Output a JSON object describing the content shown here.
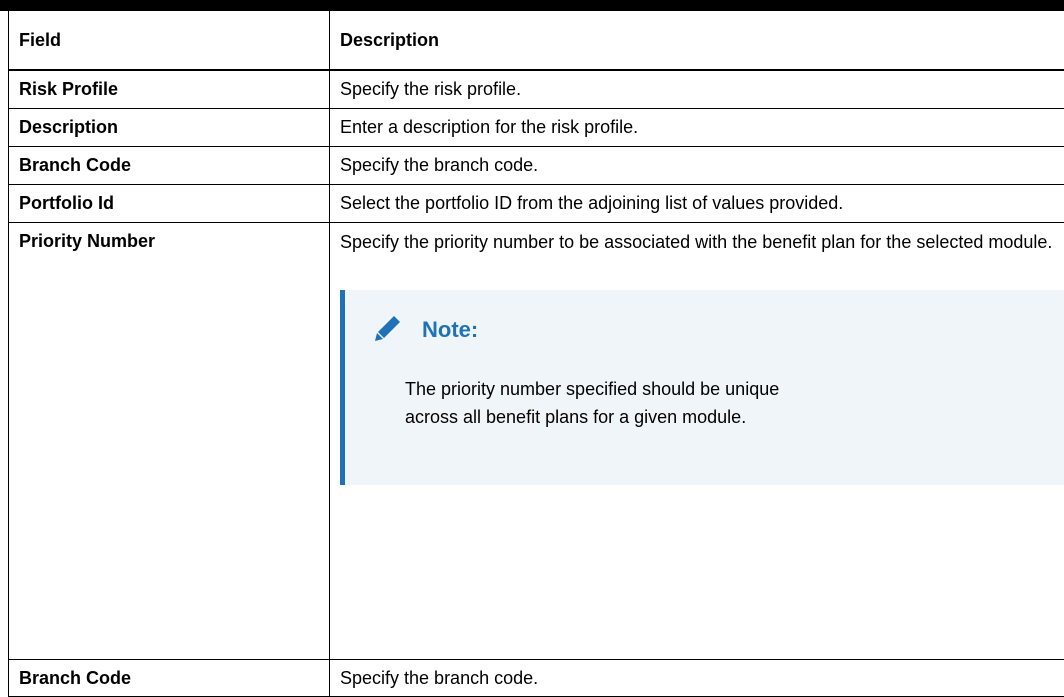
{
  "table": {
    "headers": {
      "field": "Field",
      "description": "Description"
    },
    "rows": [
      {
        "field": "Risk Profile",
        "description": "Specify the risk profile."
      },
      {
        "field": "Description",
        "description": "Enter a description for the risk profile."
      },
      {
        "field": "Branch Code",
        "description": "Specify the branch code."
      },
      {
        "field": "Portfolio Id",
        "description": "Select the portfolio ID from the adjoining list of values provided."
      },
      {
        "field": "Priority Number",
        "description": "Specify the priority number to be associated with the benefit plan for the selected module."
      },
      {
        "field": "Branch Code",
        "description": "Specify the branch code."
      }
    ]
  },
  "note": {
    "title": "Note:",
    "text": "The priority number specified should be unique across all benefit plans for a given module.",
    "icon": "pencil-icon",
    "accent_color": "#1f72b8",
    "background_color": "#f0f5fa"
  }
}
